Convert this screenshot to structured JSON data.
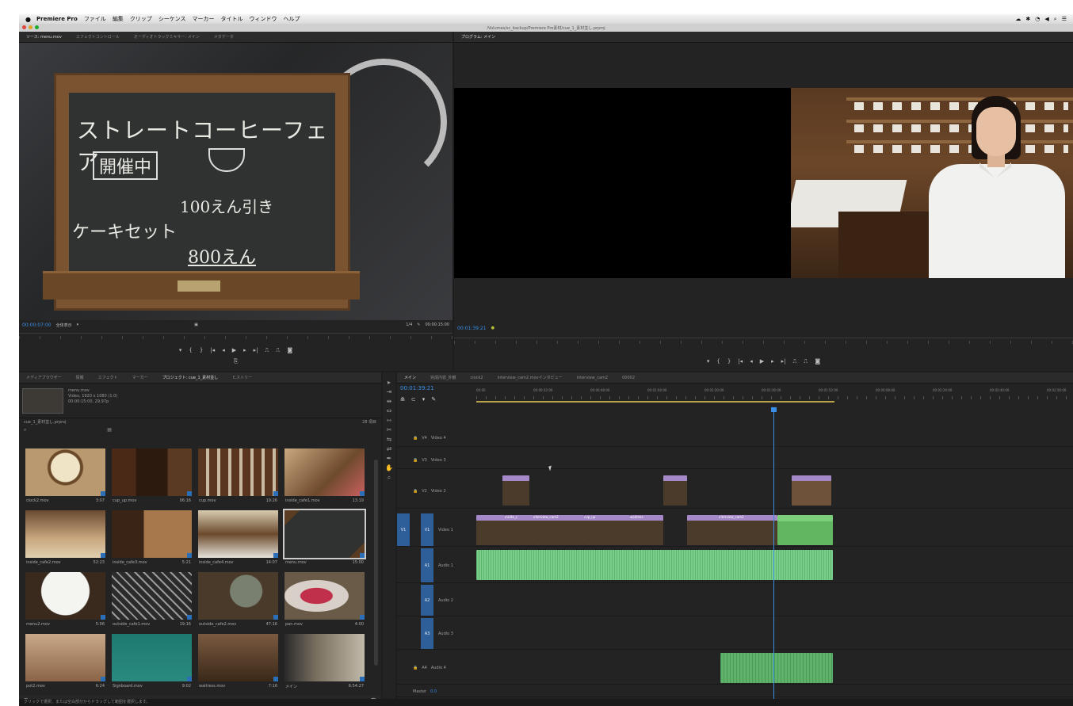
{
  "menubar": {
    "app_name": "Premiere Pro",
    "items": [
      "ファイル",
      "編集",
      "クリップ",
      "シーケンス",
      "マーカー",
      "タイトル",
      "ウィンドウ",
      "ヘルプ"
    ]
  },
  "titlebar": {
    "path": "/Volumes/sc_backup/Premiere Pro素材/cue_1_素材並し.prproj"
  },
  "source_monitor": {
    "tabs": [
      "ソース: menu.mov",
      "エフェクトコントロール",
      "オーディオトラックミキサー: メイン",
      "メタデータ"
    ],
    "timecode": "00:00:07:00",
    "fit": "全体表示",
    "scale": "1/4",
    "duration": "00:00:15:00",
    "board_lines": [
      "ストレートコーヒーフェア",
      "開催中",
      "100えん引き",
      "ケーキセット",
      "800えん"
    ]
  },
  "program_monitor": {
    "tabs": [
      "プログラム: メイン"
    ],
    "timecode": "00:01:39:21"
  },
  "project_panel": {
    "tabs": [
      "メディアブラウザー",
      "情報",
      "エフェクト",
      "マーカー",
      "プロジェクト: cue_1_素材並し",
      "ヒストリー"
    ],
    "selected_name": "menu.mov",
    "selected_meta": "Video, 1920 x 1080 (1.0)",
    "selected_meta2": "00:00:15:00, 29.97p",
    "project_file": "cue_1_素材並し.prproj",
    "item_count": "28 項目",
    "items": [
      {
        "name": "clock2.mov",
        "dur": "3:07"
      },
      {
        "name": "cup_up.mov",
        "dur": "06:16"
      },
      {
        "name": "cup.mov",
        "dur": "19:26"
      },
      {
        "name": "inside_cafe1.mov",
        "dur": "13:19"
      },
      {
        "name": "inside_cafe2.mov",
        "dur": "52:23"
      },
      {
        "name": "inside_cafe3.mov",
        "dur": "5:21"
      },
      {
        "name": "inside_cafe4.mov",
        "dur": "14:07"
      },
      {
        "name": "menu.mov",
        "dur": "15:00"
      },
      {
        "name": "menu2.mov",
        "dur": "5:06"
      },
      {
        "name": "outside_cafe1.mov",
        "dur": "19:16"
      },
      {
        "name": "outside_cafe2.mov",
        "dur": "47:16"
      },
      {
        "name": "pan.mov",
        "dur": "4:00"
      },
      {
        "name": "pot2.mov",
        "dur": "6:24"
      },
      {
        "name": "Signboard.mov",
        "dur": "9:02"
      },
      {
        "name": "waitress.mov",
        "dur": "7:16"
      },
      {
        "name": "メイン",
        "dur": "6:54:27"
      }
    ]
  },
  "timeline": {
    "tabs": [
      "メイン",
      "完成内容_外観",
      "clock2",
      "interview_cam2.movインタビュー",
      "interview_cam2",
      "00002"
    ],
    "timecode": "00:01:39:21",
    "ruler_labels": [
      "00:00",
      "00:00:32:00",
      "00:00:48:00",
      "00:01:04:00",
      "00:01:20:00",
      "00:01:36:00",
      "00:01:52:00",
      "00:00:08:00",
      "00:02:24:00",
      "00:02:40:00",
      "00:02:56:00"
    ],
    "tracks": [
      {
        "id": "V4",
        "label": "Video 4"
      },
      {
        "id": "V3",
        "label": "Video 3"
      },
      {
        "id": "V2",
        "label": "Video 2"
      },
      {
        "id": "V1",
        "label": "Video 1"
      },
      {
        "id": "A1",
        "label": "Audio 1"
      },
      {
        "id": "A2",
        "label": "Audio 2"
      },
      {
        "id": "A3",
        "label": "Audio 3"
      },
      {
        "id": "A4",
        "label": "Audio 4"
      },
      {
        "id": "Master",
        "label": "Master"
      }
    ],
    "master_level": "0.0",
    "clips_v1": [
      "inside_c",
      "interview_cam2",
      "cup_up",
      "waitress"
    ],
    "clip_v1_long": "interview_cam2"
  },
  "status_bar": "クリックで選択、または空白部分からドラッグして範囲を選択します。"
}
